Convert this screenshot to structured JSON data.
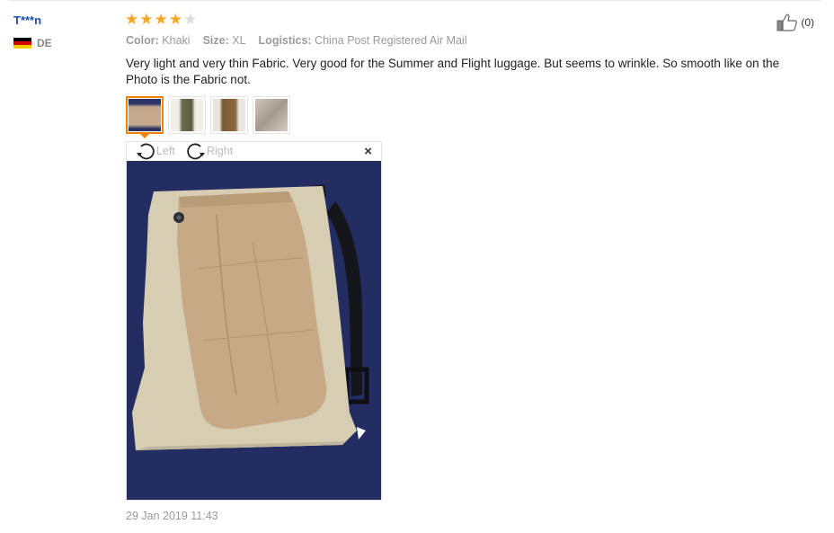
{
  "reviewer": {
    "name": "T***n",
    "country_code": "DE",
    "flag_colors": [
      "#000000",
      "#dd0000",
      "#ffce00"
    ]
  },
  "rating": {
    "stars": 4,
    "max": 5,
    "filled_color": "#f5a623",
    "empty_color": "#dddddd"
  },
  "helpful": {
    "icon": "thumbs-up-icon",
    "count": "(0)"
  },
  "attributes": [
    {
      "label": "Color:",
      "value": "Khaki"
    },
    {
      "label": "Size:",
      "value": "XL"
    },
    {
      "label": "Logistics:",
      "value": "China Post Registered Air Mail"
    }
  ],
  "feedback_text": "Very light and very thin Fabric. Very good for the Summer and Flight luggage. But seems to wrinkle. So smooth like on the Photo is the Fabric not.",
  "thumbnails": [
    {
      "selected": true
    },
    {
      "selected": false
    },
    {
      "selected": false
    },
    {
      "selected": false
    }
  ],
  "viewer": {
    "rotate_left_label": "Left",
    "rotate_right_label": "Right",
    "close_icon": "close-icon"
  },
  "date": "29 Jan 2019 11:43",
  "colors": {
    "name_link": "#1a52a8",
    "selected_border": "#f08300",
    "muted_text": "#999999"
  }
}
